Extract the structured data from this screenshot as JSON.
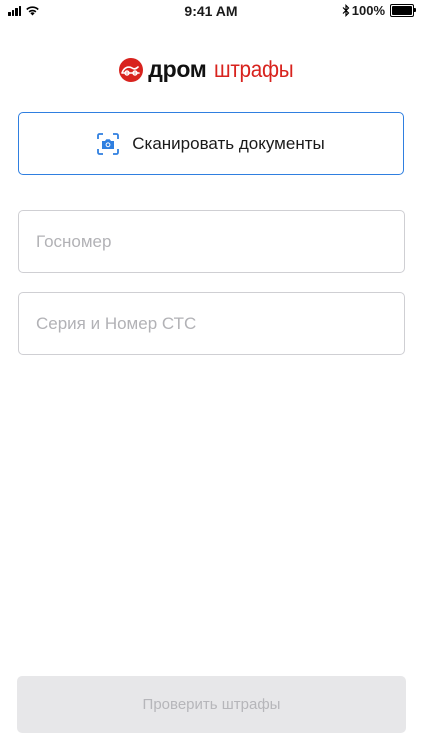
{
  "status_bar": {
    "time": "9:41 AM",
    "battery": "100%",
    "battery_level": 1.0,
    "icons": [
      "cellular-signal-icon",
      "wifi-icon",
      "bluetooth-icon",
      "battery-icon"
    ]
  },
  "logo": {
    "icon": "drom-logo-icon",
    "brand": "дром",
    "product": "штрафы",
    "brand_color": "#d8231e"
  },
  "scan": {
    "icon": "camera-scan-icon",
    "label": "Сканировать документы",
    "accent": "#2f7fe0"
  },
  "form": {
    "plate_placeholder": "Госномер",
    "plate_value": "",
    "sts_placeholder": "Серия и Номер СТС",
    "sts_value": ""
  },
  "submit": {
    "label": "Проверить штрафы",
    "disabled": true
  }
}
